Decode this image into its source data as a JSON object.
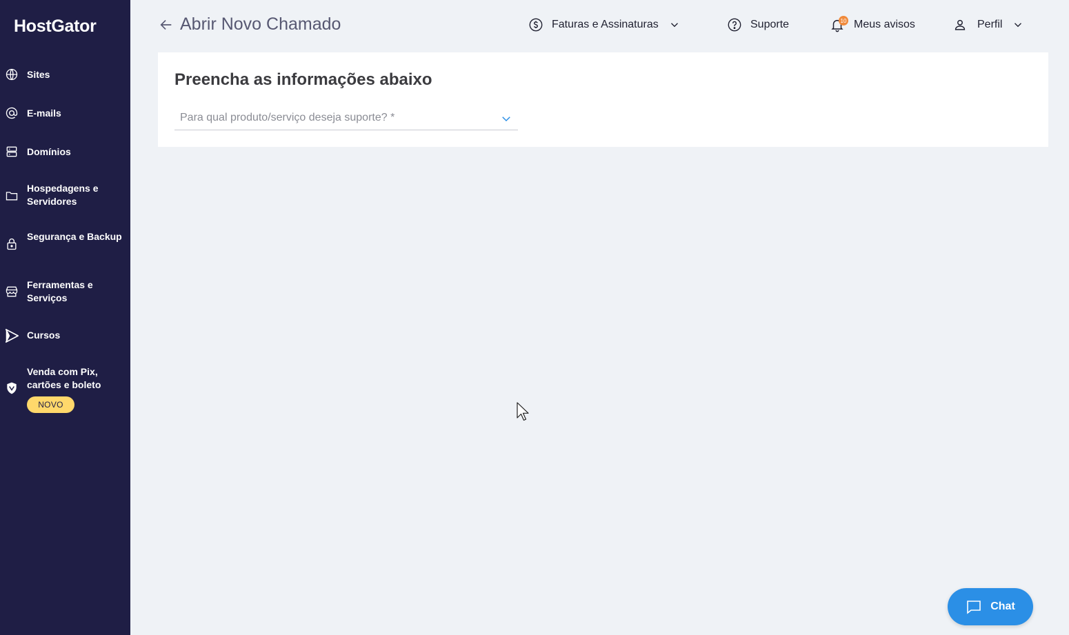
{
  "sidebar": {
    "logo": "HostGator",
    "items": [
      {
        "label": "Sites",
        "icon": "globe-icon"
      },
      {
        "label": "E-mails",
        "icon": "at-icon"
      },
      {
        "label": "Domínios",
        "icon": "server-icon"
      },
      {
        "label": "Hospedagens e Servidores",
        "icon": "folder-icon"
      },
      {
        "label": "Segurança e Backup",
        "icon": "lock-icon"
      },
      {
        "label": "Ferramentas e Serviços",
        "icon": "store-icon"
      },
      {
        "label": "Cursos",
        "icon": "play-icon"
      },
      {
        "label": "Venda com Pix, cartões e boleto",
        "icon": "shield-icon"
      }
    ],
    "badge_new": "NOVO"
  },
  "header": {
    "title": "Abrir Novo Chamado",
    "billing_label": "Faturas e Assinaturas",
    "support_label": "Suporte",
    "notices_label": "Meus avisos",
    "notices_count": "10",
    "profile_label": "Perfil"
  },
  "form": {
    "title": "Preencha as informações abaixo",
    "product_placeholder": "Para qual produto/serviço deseja suporte? *"
  },
  "chat": {
    "label": "Chat"
  },
  "colors": {
    "sidebar_bg": "#1f1e45",
    "page_bg": "#eff2f6",
    "accent": "#2b8fe6",
    "badge_bg": "#ffd86b",
    "notification": "#f08a3c"
  }
}
